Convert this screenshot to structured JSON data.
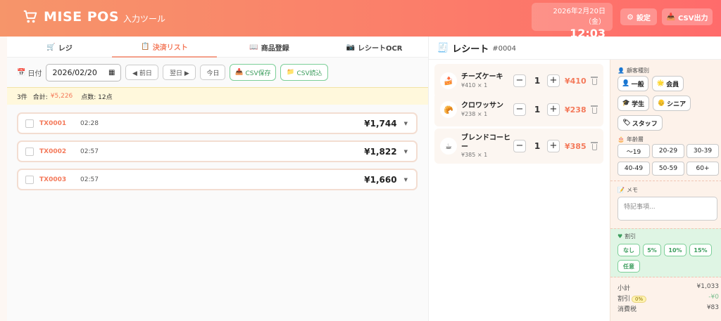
{
  "app": {
    "title": "MISE POS",
    "subtitle": "入力ツール"
  },
  "clock": {
    "date": "2026年2月20日（金）",
    "time": "12:03"
  },
  "header": {
    "settings_label": "設定",
    "csv_export_label": "CSV出力"
  },
  "tabs": [
    {
      "label": "レジ",
      "icon": "cart-icon"
    },
    {
      "label": "決済リスト",
      "icon": "clipboard-icon",
      "active": true
    },
    {
      "label": "商品登録",
      "icon": "book-icon"
    },
    {
      "label": "レシートOCR",
      "icon": "camera-icon"
    }
  ],
  "toolbar": {
    "date_label": "日付",
    "date_value": "2026/02/20",
    "prev_label": "◀ 前日",
    "next_label": "翌日 ▶",
    "today_label": "今日",
    "csv_save_label": "CSV保存",
    "csv_load_label": "CSV読込"
  },
  "summary": {
    "count": "3件",
    "total_label": "合計:",
    "total_value": "¥5,226",
    "points": "点数: 12点"
  },
  "transactions": [
    {
      "id": "TX0001",
      "time": "02:28",
      "amount": "¥1,744"
    },
    {
      "id": "TX0002",
      "time": "02:57",
      "amount": "¥1,822"
    },
    {
      "id": "TX0003",
      "time": "02:57",
      "amount": "¥1,660"
    }
  ],
  "receipt": {
    "title": "レシート",
    "number": "#0004",
    "items": [
      {
        "name": "チーズケーキ",
        "sub": "¥410 × 1",
        "qty": "1",
        "price": "¥410",
        "icon": "cake-icon"
      },
      {
        "name": "クロワッサン",
        "sub": "¥238 × 1",
        "qty": "1",
        "price": "¥238",
        "icon": "croissant-icon"
      },
      {
        "name": "ブレンドコーヒー",
        "sub": "¥385 × 1",
        "qty": "1",
        "price": "¥385",
        "icon": "coffee-icon"
      }
    ]
  },
  "customer": {
    "title": "顧客種別",
    "types": [
      "一般",
      "会員",
      "学生",
      "シニア",
      "スタッフ"
    ],
    "age_title": "年齢層",
    "ages": [
      "〜19",
      "20-29",
      "30-39",
      "40-49",
      "50-59",
      "60+"
    ]
  },
  "memo": {
    "title": "メモ",
    "placeholder": "特記事項..."
  },
  "discount": {
    "title": "割引",
    "options": [
      "なし",
      "5%",
      "10%",
      "15%",
      "任意"
    ]
  },
  "totals": {
    "subtotal_label": "小計",
    "subtotal": "¥1,033",
    "discount_label": "割引",
    "discount_badge": "0%",
    "discount": "-¥0",
    "tax_label": "消費税",
    "tax": "¥83"
  },
  "colors": {
    "accent": "#f47a5b",
    "green": "#3c9d5d"
  }
}
